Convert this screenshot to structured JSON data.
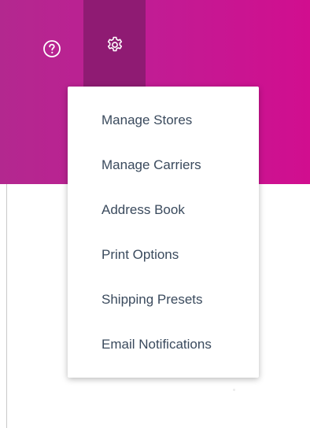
{
  "header": {
    "help_icon": "help-circle-icon",
    "settings_icon": "gear-icon",
    "colors": {
      "header_gradient_start": "#b3288f",
      "header_gradient_end": "#d10e8f",
      "settings_active_bg": "#8f1b73",
      "menu_text": "#3a4a5d"
    }
  },
  "settings_menu": {
    "items": [
      {
        "label": "Manage Stores"
      },
      {
        "label": "Manage Carriers"
      },
      {
        "label": "Address Book"
      },
      {
        "label": "Print Options"
      },
      {
        "label": "Shipping Presets"
      },
      {
        "label": "Email Notifications"
      }
    ]
  }
}
